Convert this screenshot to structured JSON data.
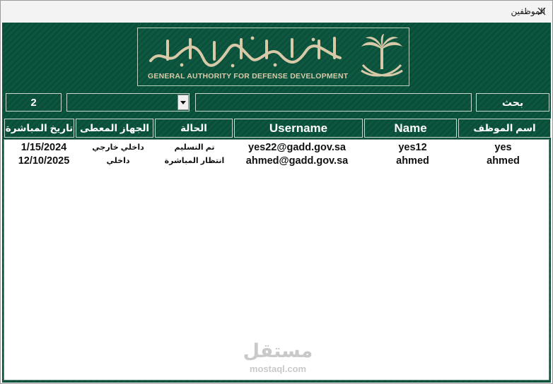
{
  "window": {
    "title": "الموظفين"
  },
  "banner": {
    "arabic_name": "الهيئة العامة للتطوير الدفاعي",
    "english_name": "GENERAL AUTHORITY FOR DEFENSE DEVELOPMENT"
  },
  "search": {
    "button_label": "بحث",
    "input_value": "",
    "filter_value": "",
    "result_count": "2"
  },
  "table": {
    "columns": [
      "اسم الموظف",
      "Name",
      "Username",
      "الحالة",
      "الجهاز المعطى",
      "تاريخ المباشرة"
    ],
    "rows": [
      {
        "employee_name": "yes",
        "name": "yes12",
        "username": "yes22@gadd.gov.sa",
        "status": "تم التسليم",
        "device": "داخلي خارجي",
        "start_date": "1/15/2024"
      },
      {
        "employee_name": "ahmed",
        "name": "ahmed",
        "username": "ahmed@gadd.gov.sa",
        "status": "انتظار المباشرة",
        "device": "داخلي",
        "start_date": "12/10/2025"
      }
    ]
  },
  "watermark": {
    "arabic": "مستقل",
    "latin": "mostaql.com"
  },
  "colors": {
    "background_green": "#0d5640",
    "banner_gold": "#d8c9a8",
    "border": "#c9d9cf",
    "text_white": "#ffffff"
  }
}
